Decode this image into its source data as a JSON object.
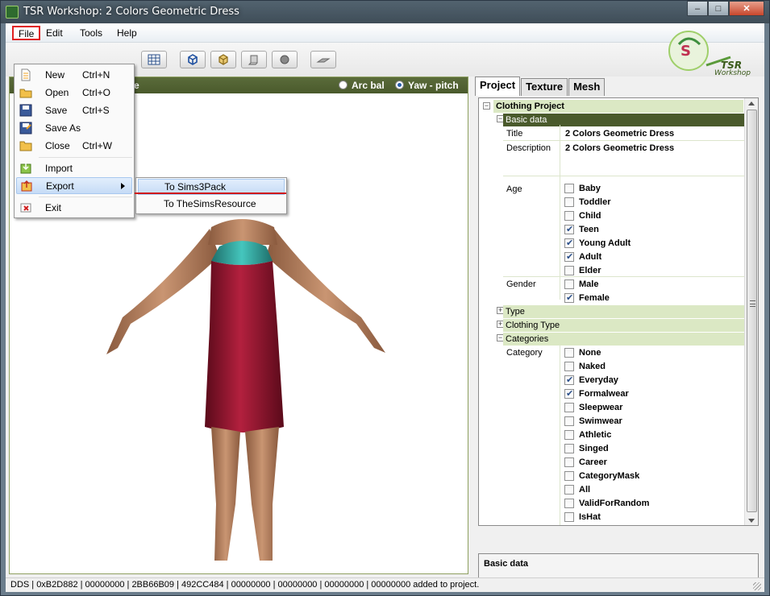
{
  "window": {
    "title": "TSR Workshop: 2 Colors Geometric Dress",
    "min": "‒",
    "max": "□",
    "close": "✕"
  },
  "menubar": {
    "items": [
      {
        "label": "File",
        "active": true
      },
      {
        "label": "Edit"
      },
      {
        "label": "Tools"
      },
      {
        "label": "Help"
      }
    ]
  },
  "file_menu": {
    "items": [
      {
        "label": "New",
        "shortcut": "Ctrl+N",
        "icon": "new-file-icon"
      },
      {
        "label": "Open",
        "shortcut": "Ctrl+O",
        "icon": "open-folder-icon"
      },
      {
        "label": "Save",
        "shortcut": "Ctrl+S",
        "icon": "save-icon"
      },
      {
        "label": "Save As",
        "shortcut": "",
        "icon": "save-as-icon"
      },
      {
        "label": "Close",
        "shortcut": "Ctrl+W",
        "icon": "close-folder-icon"
      },
      {
        "label": "Import",
        "shortcut": "",
        "icon": "import-icon"
      },
      {
        "label": "Export",
        "shortcut": "",
        "icon": "export-icon",
        "highlighted": true
      },
      {
        "label": "Exit",
        "shortcut": "",
        "icon": "exit-icon"
      }
    ]
  },
  "export_submenu": {
    "items": [
      {
        "label": "To Sims3Pack",
        "highlighted": true
      },
      {
        "label": "To TheSimsResource"
      }
    ]
  },
  "viewport": {
    "header_text": "otate",
    "mode_options": [
      {
        "label": "Arc bal",
        "checked": false
      },
      {
        "label": "Yaw - pitch",
        "checked": true
      }
    ]
  },
  "tabs": [
    {
      "label": "Project",
      "active": true
    },
    {
      "label": "Texture"
    },
    {
      "label": "Mesh"
    }
  ],
  "project": {
    "root_label": "Clothing Project",
    "basic_data_label": "Basic data",
    "title_label": "Title",
    "title_value": "2 Colors Geometric Dress",
    "description_label": "Description",
    "description_value": "2 Colors Geometric Dress",
    "age_label": "Age",
    "ages": [
      {
        "label": "Baby",
        "checked": false
      },
      {
        "label": "Toddler",
        "checked": false
      },
      {
        "label": "Child",
        "checked": false
      },
      {
        "label": "Teen",
        "checked": true
      },
      {
        "label": "Young Adult",
        "checked": true
      },
      {
        "label": "Adult",
        "checked": true
      },
      {
        "label": "Elder",
        "checked": false
      }
    ],
    "gender_label": "Gender",
    "genders": [
      {
        "label": "Male",
        "checked": false
      },
      {
        "label": "Female",
        "checked": true
      }
    ],
    "type_label": "Type",
    "clothing_type_label": "Clothing Type",
    "categories_label": "Categories",
    "category_label": "Category",
    "categories": [
      {
        "label": "None",
        "checked": false
      },
      {
        "label": "Naked",
        "checked": false
      },
      {
        "label": "Everyday",
        "checked": true
      },
      {
        "label": "Formalwear",
        "checked": true
      },
      {
        "label": "Sleepwear",
        "checked": false
      },
      {
        "label": "Swimwear",
        "checked": false
      },
      {
        "label": "Athletic",
        "checked": false
      },
      {
        "label": "Singed",
        "checked": false
      },
      {
        "label": "Career",
        "checked": false
      },
      {
        "label": "CategoryMask",
        "checked": false
      },
      {
        "label": "All",
        "checked": false
      },
      {
        "label": "ValidForRandom",
        "checked": false
      },
      {
        "label": "IsHat",
        "checked": false
      }
    ]
  },
  "description_panel": {
    "text": "Basic data"
  },
  "status": {
    "text": "DDS | 0xB2D882 | 00000000 | 2BB66B09 | 492CC484 | 00000000 | 00000000 | 00000000 | 00000000 added to project."
  },
  "colors": {
    "accent_green": "#4a5a2c",
    "light_green": "#dbe8c4",
    "dress": "#9a1234",
    "bodice": "#2aa8a0",
    "skin": "#b98462"
  }
}
